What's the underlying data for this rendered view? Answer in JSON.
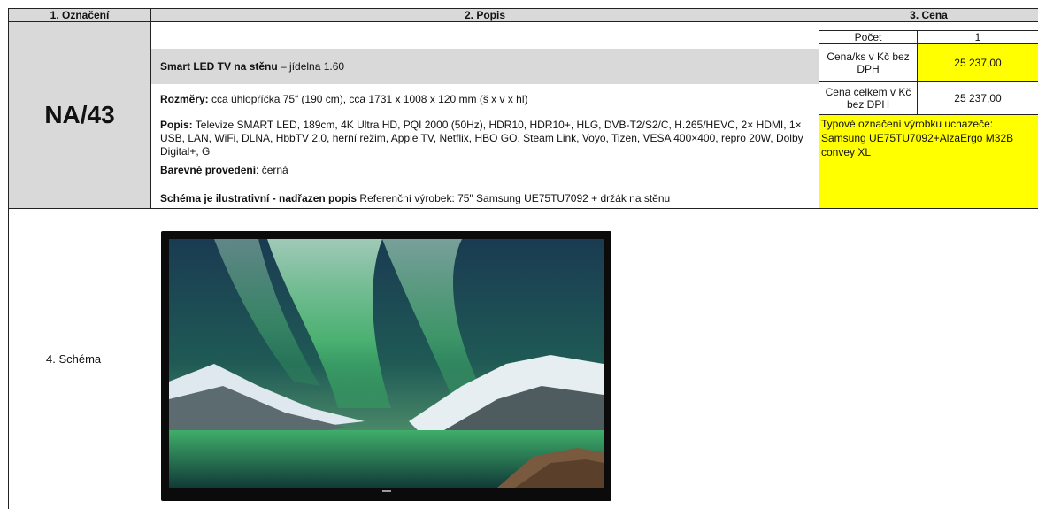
{
  "headers": {
    "col1": "1. Označení",
    "col2": "2. Popis",
    "col3": "3. Cena"
  },
  "item": {
    "code": "NA/43",
    "title_bold": "Smart LED TV na stěnu",
    "title_rest": " – jídelna 1.60",
    "dims_label": "Rozměry:",
    "dims_value": " cca   úhlopříčka 75“ (190 cm),  cca 1731 x 1008 x 120 mm (š x v x hl)",
    "desc_label": "Popis:",
    "desc_value": " Televize SMART LED, 189cm, 4K Ultra HD, PQI 2000 (50Hz), HDR10, HDR10+, HLG, DVB-T2/S2/C, H.265/HEVC, 2× HDMI, 1× USB, LAN, WiFi, DLNA, HbbTV 2.0, herní režim, Apple TV, Netflix, HBO GO, Steam Link, Voyo, Tizen, VESA 400×400, repro 20W, Dolby Digital+, G",
    "color_label": "Barevné provedení",
    "color_value": ": černá",
    "schema_note_bold": "Schéma je ilustrativní - nadřazen popis",
    "schema_note_rest": "  Referenční výrobek: 75\" Samsung UE75TU7092 + držák na stěnu"
  },
  "price": {
    "count_label": "Počet",
    "count_value": "1",
    "unit_label": "Cena/ks v Kč bez DPH",
    "unit_value": "25 237,00",
    "total_label": "Cena celkem v Kč bez DPH",
    "total_value": "25 237,00",
    "bidder_text": "Typové označení výrobku uchazeče: Samsung UE75TU7092+AlzaErgo M32B convey XL"
  },
  "schema": {
    "label": "4. Schéma"
  },
  "colors": {
    "header_gray": "#d9d9d9",
    "highlight_yellow": "#ffff00"
  }
}
